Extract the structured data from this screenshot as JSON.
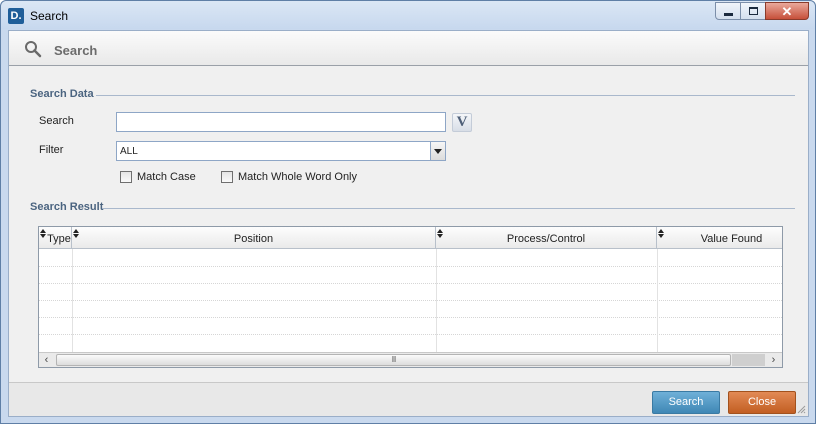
{
  "window": {
    "logo_letter": "D.",
    "title": "Search",
    "min_glyph": "—",
    "close_glyph": "✕"
  },
  "header": {
    "title": "Search",
    "icon": "magnifier-icon"
  },
  "search_data": {
    "section_label": "Search Data",
    "search_label": "Search",
    "search_value": "",
    "search_placeholder": "",
    "v_button_label": "V",
    "filter_label": "Filter",
    "filter_value": "ALL",
    "match_case_label": "Match Case",
    "match_case_checked": false,
    "match_whole_word_label": "Match Whole Word Only",
    "match_whole_word_checked": false
  },
  "search_result": {
    "section_label": "Search Result",
    "columns": [
      "Type",
      "Position",
      "Process/Control",
      "Value Found"
    ],
    "rows": [],
    "scroll_thumb_grip": "III",
    "scroll_left": "‹",
    "scroll_right": "›"
  },
  "footer": {
    "search_button": "Search",
    "close_button": "Close"
  },
  "colors": {
    "search_button": "#4a94c2",
    "close_button": "#d06d33",
    "section_label": "#4b6480"
  }
}
